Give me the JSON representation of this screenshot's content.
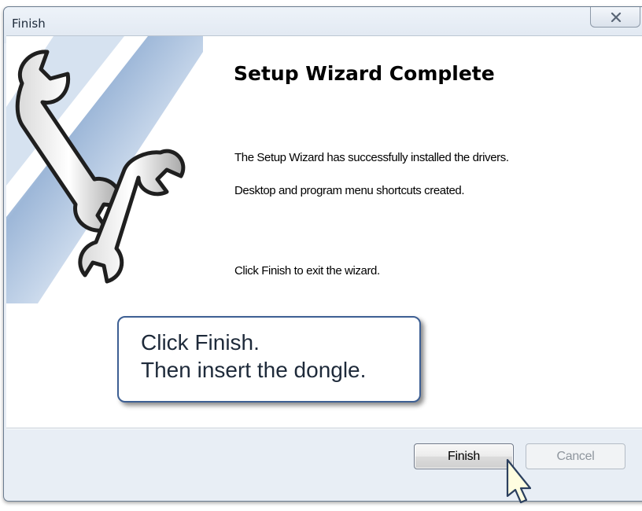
{
  "window": {
    "title": "Finish"
  },
  "main": {
    "heading": "Setup Wizard Complete",
    "message_installed": "The Setup Wizard has successfully installed the drivers.",
    "message_shortcuts": "Desktop and program menu shortcuts created.",
    "message_click_finish": "Click Finish to exit the wizard."
  },
  "callout": {
    "line1": "Click Finish.",
    "line2": "Then insert the dongle."
  },
  "buttons": {
    "finish_label": "Finish",
    "cancel_label": "Cancel"
  },
  "colors": {
    "callout_border": "#3d5f93",
    "banner_blue": "#7fa3cf"
  }
}
